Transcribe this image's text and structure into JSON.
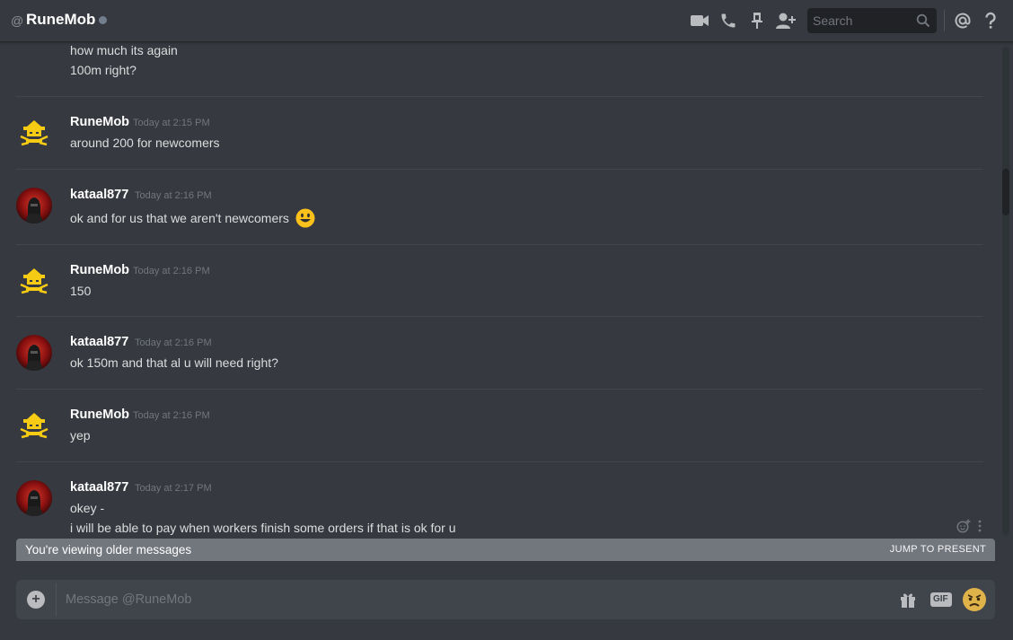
{
  "header": {
    "at": "@",
    "title": "RuneMob",
    "search_placeholder": "Search",
    "icons": [
      "video-call-icon",
      "voice-call-icon",
      "pin-icon",
      "add-friend-icon",
      "search-icon",
      "mentions-icon",
      "help-icon"
    ]
  },
  "messages": {
    "continuation": [
      "how much its again",
      "100m right?"
    ],
    "items": [
      {
        "author": "RuneMob",
        "time": "Today at 2:15 PM",
        "lines": [
          "around 200 for newcomers"
        ]
      },
      {
        "author": "kataal877",
        "time": "Today at 2:16 PM",
        "lines": [
          "ok and for us that we aren't newcomers"
        ],
        "emoji": "smiley"
      },
      {
        "author": "RuneMob",
        "time": "Today at 2:16 PM",
        "lines": [
          "150"
        ]
      },
      {
        "author": "kataal877",
        "time": "Today at 2:16 PM",
        "lines": [
          "ok 150m and that al u will need right?"
        ]
      },
      {
        "author": "RuneMob",
        "time": "Today at 2:16 PM",
        "lines": [
          "yep"
        ]
      },
      {
        "author": "kataal877",
        "time": "Today at 2:17 PM",
        "lines": [
          "okey -",
          "i will be able to pay when workers finish some orders if that is ok for u"
        ]
      }
    ]
  },
  "older_bar": {
    "text": "You're viewing older messages",
    "jump": "JUMP TO PRESENT"
  },
  "composer": {
    "placeholder": "Message @RuneMob",
    "gif_label": "GIF"
  },
  "colors": {
    "background": "#36393f",
    "composer": "#40444b",
    "older_bar": "#72767d",
    "runemob_avatar": "#f5cb14",
    "kataal_avatar": "#8b1010"
  }
}
